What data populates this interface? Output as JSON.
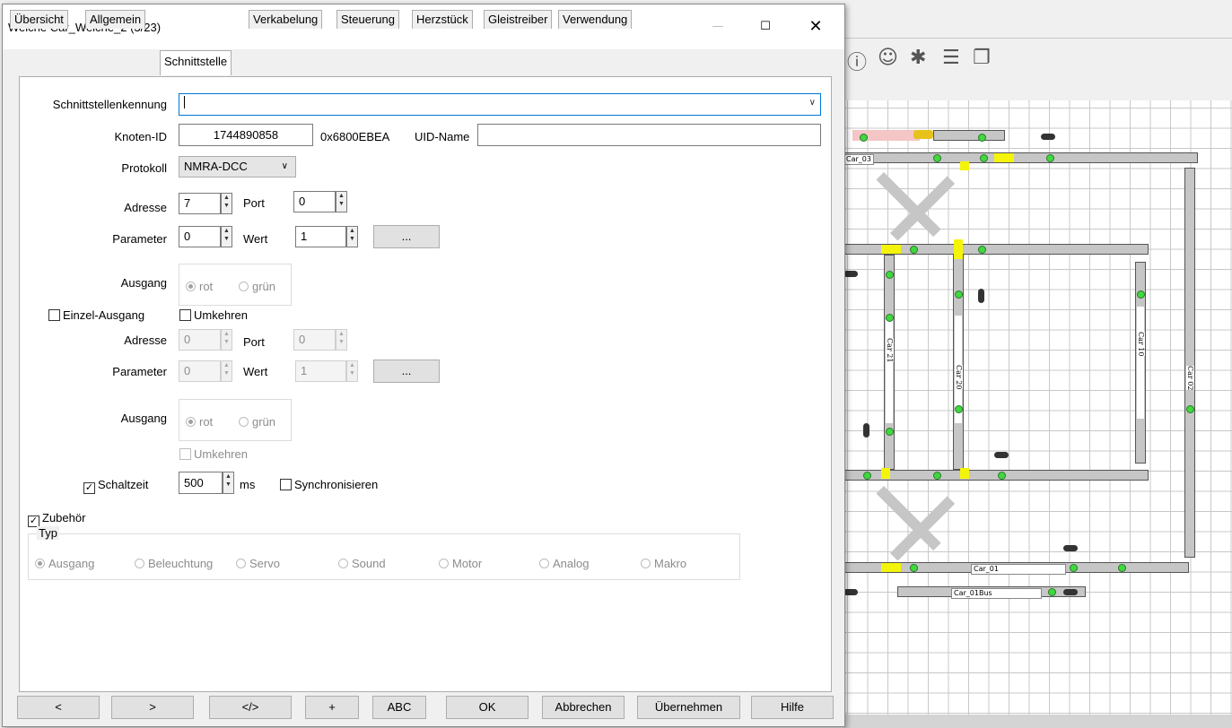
{
  "dialog": {
    "title": "Weiche Car_Weiche_2 (3/23)",
    "tabs": [
      "Übersicht",
      "Allgemein",
      "Schnittstelle",
      "Verkabelung",
      "Steuerung",
      "Herzstück",
      "Gleistreiber",
      "Verwendung"
    ],
    "active_tab": "Schnittstelle"
  },
  "form": {
    "schnittstellenkennung_label": "Schnittstellenkennung",
    "schnittstellenkennung_value": "",
    "knoten_id_label": "Knoten-ID",
    "knoten_id_value": "1744890858",
    "knoten_hex": "0x6800EBEA",
    "uid_name_label": "UID-Name",
    "uid_name_value": "",
    "protokoll_label": "Protokoll",
    "protokoll_value": "NMRA-DCC",
    "adresse_label": "Adresse",
    "adresse_value": "7",
    "port_label": "Port",
    "port_value": "0",
    "parameter_label": "Parameter",
    "parameter_value": "0",
    "wert_label": "Wert",
    "wert_value": "1",
    "more_label": "...",
    "ausgang_label": "Ausgang",
    "rot_label": "rot",
    "gruen_label": "grün",
    "einzel_ausgang_label": "Einzel-Ausgang",
    "umkehren_label": "Umkehren",
    "adresse2_value": "0",
    "port2_value": "0",
    "parameter2_value": "0",
    "wert2_value": "1",
    "schaltzeit_label": "Schaltzeit",
    "schaltzeit_value": "500",
    "ms_label": "ms",
    "synchronisieren_label": "Synchronisieren",
    "zubehoer_label": "Zubehör",
    "typ_label": "Typ",
    "typ_options": [
      "Ausgang",
      "Beleuchtung",
      "Servo",
      "Sound",
      "Motor",
      "Analog",
      "Makro"
    ]
  },
  "bottom_buttons": [
    "<",
    ">",
    "</>",
    "+",
    "ABC",
    "OK",
    "Abbrechen",
    "Übernehmen",
    "Hilfe"
  ],
  "background": {
    "toolbar_icons": [
      "info-icon",
      "chat-icon",
      "bug-icon",
      "list-icon",
      "copy-icon"
    ],
    "track_labels": [
      "Car_03",
      "Car 21",
      "Car 20",
      "Car 10",
      "Car 02",
      "Car_01",
      "Car_01Bus"
    ]
  }
}
